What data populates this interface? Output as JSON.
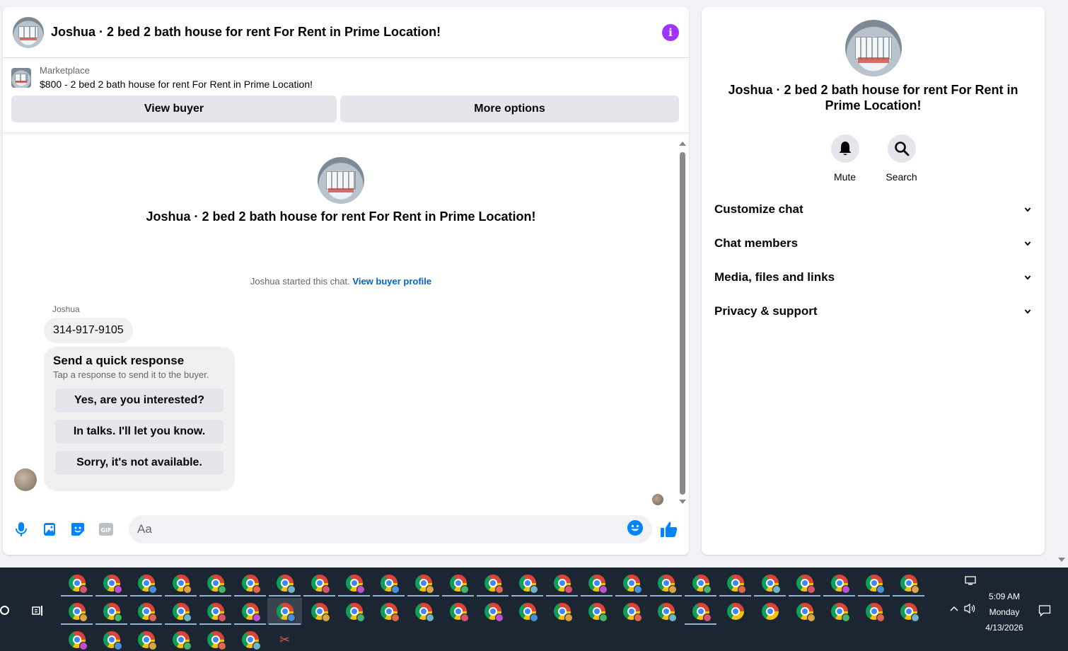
{
  "header": {
    "title": "Joshua · 2 bed 2 bath house for rent For Rent in Prime Location!"
  },
  "marketplace": {
    "label": "Marketplace",
    "listing": "$800 - 2 bed 2 bath house for rent For Rent in Prime Location!",
    "view_buyer": "View buyer",
    "more_options": "More options"
  },
  "conversation": {
    "title": "Joshua · 2 bed 2 bath house for rent For Rent in Prime Location!",
    "started_text": "Joshua started this chat.",
    "view_profile_link": "View buyer profile",
    "sender": "Joshua",
    "message": "314-917-9105",
    "quick_response": {
      "title": "Send a quick response",
      "subtitle": "Tap a response to send it to the buyer.",
      "options": [
        "Yes, are you interested?",
        "In talks. I'll let you know.",
        "Sorry, it's not available."
      ]
    }
  },
  "composer": {
    "placeholder": "Aa",
    "icons": [
      "microphone-icon",
      "photo-icon",
      "sticker-icon",
      "gif-icon",
      "emoji-icon",
      "thumbs-up-icon"
    ]
  },
  "info_panel": {
    "title": "Joshua · 2 bed 2 bath house for rent For Rent in Prime Location!",
    "actions": [
      {
        "label": "Mute",
        "icon": "bell-icon"
      },
      {
        "label": "Search",
        "icon": "search-icon"
      }
    ],
    "sections": [
      "Customize chat",
      "Chat members",
      "Media, files and links",
      "Privacy & support"
    ]
  },
  "taskbar": {
    "time": "5:09 AM",
    "day": "Monday",
    "date": "4/13/2026"
  },
  "colors": {
    "accent_blue": "#0084ff",
    "info_purple": "#a033ff",
    "link_blue": "#0064d1"
  }
}
